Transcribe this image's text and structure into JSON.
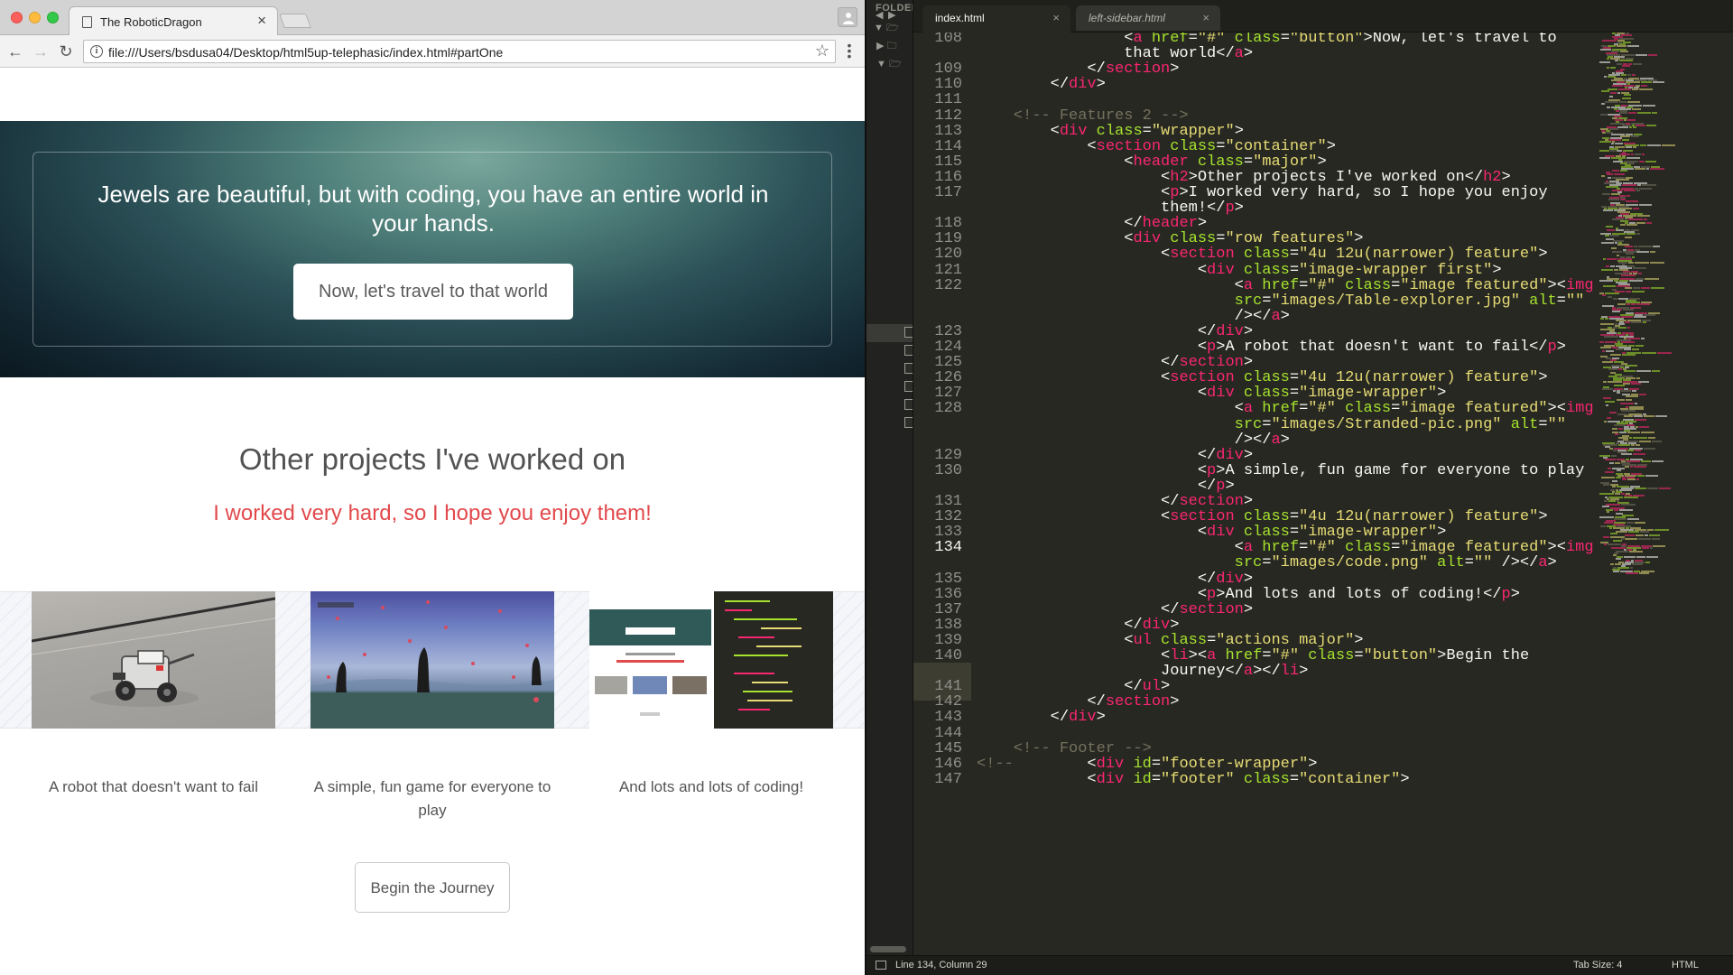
{
  "browser": {
    "tab_title": "The RoboticDragon",
    "url": "file:///Users/bsdusa04/Desktop/html5up-telephasic/index.html#partOne",
    "page": {
      "hero_text": "Jewels are beautiful, but with coding, you have an entire world in your hands.",
      "hero_button": "Now, let's travel to that world",
      "projects_heading": "Other projects I've worked on",
      "projects_subheading": "I worked very hard, so I hope you enjoy them!",
      "features": [
        {
          "caption": "A robot that doesn't want to fail",
          "image": "robot-photo"
        },
        {
          "caption": "A simple, fun game for everyone to play",
          "image": "game-screenshot"
        },
        {
          "caption": "And lots and lots of coding!",
          "image": "code-screenshot"
        }
      ],
      "journey_button": "Begin the Journey"
    }
  },
  "editor": {
    "sidebar_label": "FOLDER",
    "tabs": [
      {
        "label": "index.html",
        "active": true
      },
      {
        "label": "left-sidebar.html",
        "active": false
      }
    ],
    "status": {
      "position": "Line 134, Column 29",
      "tab_size": "Tab Size: 4",
      "syntax": "HTML"
    },
    "lines": [
      {
        "n": "108",
        "code": "                <a href=\"#\" class=\"button\">Now, let's travel to"
      },
      {
        "n": "",
        "code": "                that world</a>"
      },
      {
        "n": "109",
        "code": "            </section>"
      },
      {
        "n": "110",
        "code": "        </div>"
      },
      {
        "n": "111",
        "code": ""
      },
      {
        "n": "112",
        "code": "    <!-- Features 2 -->"
      },
      {
        "n": "113",
        "code": "        <div class=\"wrapper\">"
      },
      {
        "n": "114",
        "code": "            <section class=\"container\">"
      },
      {
        "n": "115",
        "code": "                <header class=\"major\">"
      },
      {
        "n": "116",
        "code": "                    <h2>Other projects I've worked on</h2>"
      },
      {
        "n": "117",
        "code": "                    <p>I worked very hard, so I hope you enjoy"
      },
      {
        "n": "",
        "code": "                    them!</p>"
      },
      {
        "n": "118",
        "code": "                </header>"
      },
      {
        "n": "119",
        "code": "                <div class=\"row features\">"
      },
      {
        "n": "120",
        "code": "                    <section class=\"4u 12u(narrower) feature\">"
      },
      {
        "n": "121",
        "code": "                        <div class=\"image-wrapper first\">"
      },
      {
        "n": "122",
        "code": "                            <a href=\"#\" class=\"image featured\"><img"
      },
      {
        "n": "",
        "code": "                            src=\"images/Table-explorer.jpg\" alt=\"\""
      },
      {
        "n": "",
        "code": "                            /></a>"
      },
      {
        "n": "123",
        "code": "                        </div>"
      },
      {
        "n": "124",
        "code": "                        <p>A robot that doesn't want to fail</p>"
      },
      {
        "n": "125",
        "code": "                    </section>"
      },
      {
        "n": "126",
        "code": "                    <section class=\"4u 12u(narrower) feature\">"
      },
      {
        "n": "127",
        "code": "                        <div class=\"image-wrapper\">"
      },
      {
        "n": "128",
        "code": "                            <a href=\"#\" class=\"image featured\"><img"
      },
      {
        "n": "",
        "code": "                            src=\"images/Stranded-pic.png\" alt=\"\""
      },
      {
        "n": "",
        "code": "                            /></a>"
      },
      {
        "n": "129",
        "code": "                        </div>"
      },
      {
        "n": "130",
        "code": "                        <p>A simple, fun game for everyone to play"
      },
      {
        "n": "",
        "code": "                        </p>"
      },
      {
        "n": "131",
        "code": "                    </section>"
      },
      {
        "n": "132",
        "code": "                    <section class=\"4u 12u(narrower) feature\">"
      },
      {
        "n": "133",
        "code": "                        <div class=\"image-wrapper\">"
      },
      {
        "n": "134",
        "code": "                            <a href=\"#\" class=\"image featured\"><img"
      },
      {
        "n": "",
        "code": "                            src=\"images/code.png\" alt=\"\" /></a>"
      },
      {
        "n": "135",
        "code": "                        </div>"
      },
      {
        "n": "136",
        "code": "                        <p>And lots and lots of coding!</p>"
      },
      {
        "n": "137",
        "code": "                    </section>"
      },
      {
        "n": "138",
        "code": "                </div>"
      },
      {
        "n": "139",
        "code": "                <ul class=\"actions major\">"
      },
      {
        "n": "140",
        "code": "                    <li><a href=\"#\" class=\"button\">Begin the"
      },
      {
        "n": "",
        "code": "                    Journey</a></li>"
      },
      {
        "n": "141",
        "code": "                </ul>"
      },
      {
        "n": "142",
        "code": "            </section>"
      },
      {
        "n": "143",
        "code": "        </div>"
      },
      {
        "n": "144",
        "code": ""
      },
      {
        "n": "145",
        "code": "    <!-- Footer -->"
      },
      {
        "n": "146",
        "code": "<!--        <div id=\"footer-wrapper\">"
      },
      {
        "n": "147",
        "code": "            <div id=\"footer\" class=\"container\">"
      }
    ]
  },
  "colors": {
    "tag": "#f92672",
    "attr": "#a6e22e",
    "string": "#e6db74",
    "comment": "#75715e",
    "accent_red": "#e2494c"
  }
}
